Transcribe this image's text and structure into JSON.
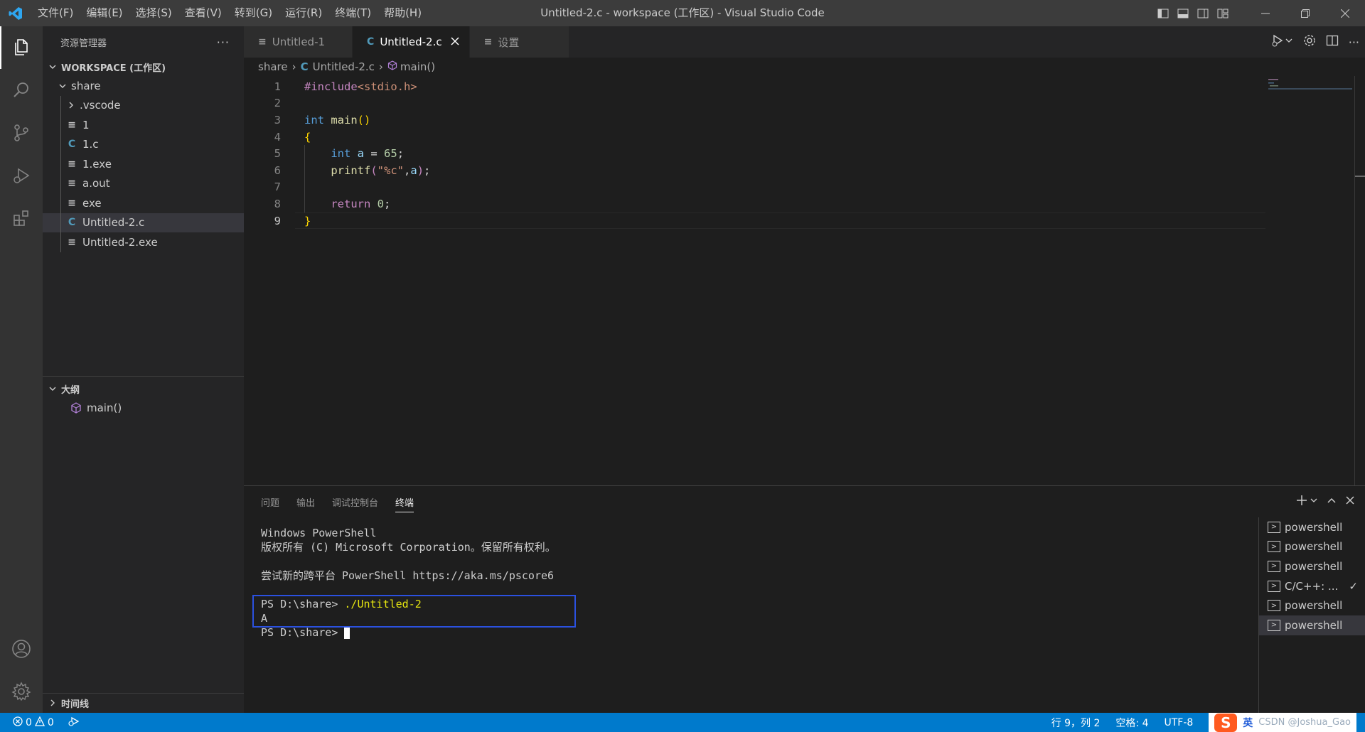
{
  "titlebar": {
    "menus": [
      "文件(F)",
      "编辑(E)",
      "选择(S)",
      "查看(V)",
      "转到(G)",
      "运行(R)",
      "终端(T)",
      "帮助(H)"
    ],
    "window_title": "Untitled-2.c - workspace (工作区) - Visual Studio Code"
  },
  "sidebar": {
    "header": "资源管理器",
    "more": "···",
    "workspace_title": "WORKSPACE (工作区)",
    "root_folder": "share",
    "items": [
      {
        "label": ".vscode",
        "kind": "folder"
      },
      {
        "label": "1",
        "kind": "file"
      },
      {
        "label": "1.c",
        "kind": "c-file"
      },
      {
        "label": "1.exe",
        "kind": "file"
      },
      {
        "label": "a.out",
        "kind": "file"
      },
      {
        "label": "exe",
        "kind": "file"
      },
      {
        "label": "Untitled-2.c",
        "kind": "c-file"
      },
      {
        "label": "Untitled-2.exe",
        "kind": "file"
      }
    ],
    "outline_title": "大纲",
    "outline_item": "main()",
    "timeline_title": "时间线"
  },
  "editor": {
    "tabs": [
      {
        "label": "Untitled-1",
        "icon": "≡"
      },
      {
        "label": "Untitled-2.c",
        "icon": "C"
      },
      {
        "label": "设置",
        "icon": "≡"
      }
    ],
    "breadcrumb": [
      "share",
      "Untitled-2.c",
      "main()"
    ],
    "line_numbers": [
      "1",
      "2",
      "3",
      "4",
      "5",
      "6",
      "7",
      "8",
      "9"
    ]
  },
  "panel": {
    "tabs": [
      "问题",
      "输出",
      "调试控制台",
      "终端"
    ],
    "terminal_lines": [
      "Windows PowerShell",
      "版权所有 (C) Microsoft Corporation。保留所有权利。",
      "",
      "尝试新的跨平台 PowerShell https://aka.ms/pscore6",
      ""
    ],
    "prompt": "PS D:\\share> ",
    "command": "./Untitled-2",
    "output": "A",
    "prompt2": "PS D:\\share> ",
    "terminals": [
      "powershell",
      "powershell",
      "powershell",
      "C/C++: ...",
      "powershell",
      "powershell"
    ]
  },
  "statusbar": {
    "errors": "0",
    "warnings": "0",
    "position": "行 9，列 2",
    "spaces": "空格: 4",
    "encoding": "UTF-8",
    "ime_lang": "英",
    "watermark": "CSDN @Joshua_Gao"
  },
  "colors": {
    "accent": "#007acc",
    "highlight_box": "#2b51e0"
  }
}
